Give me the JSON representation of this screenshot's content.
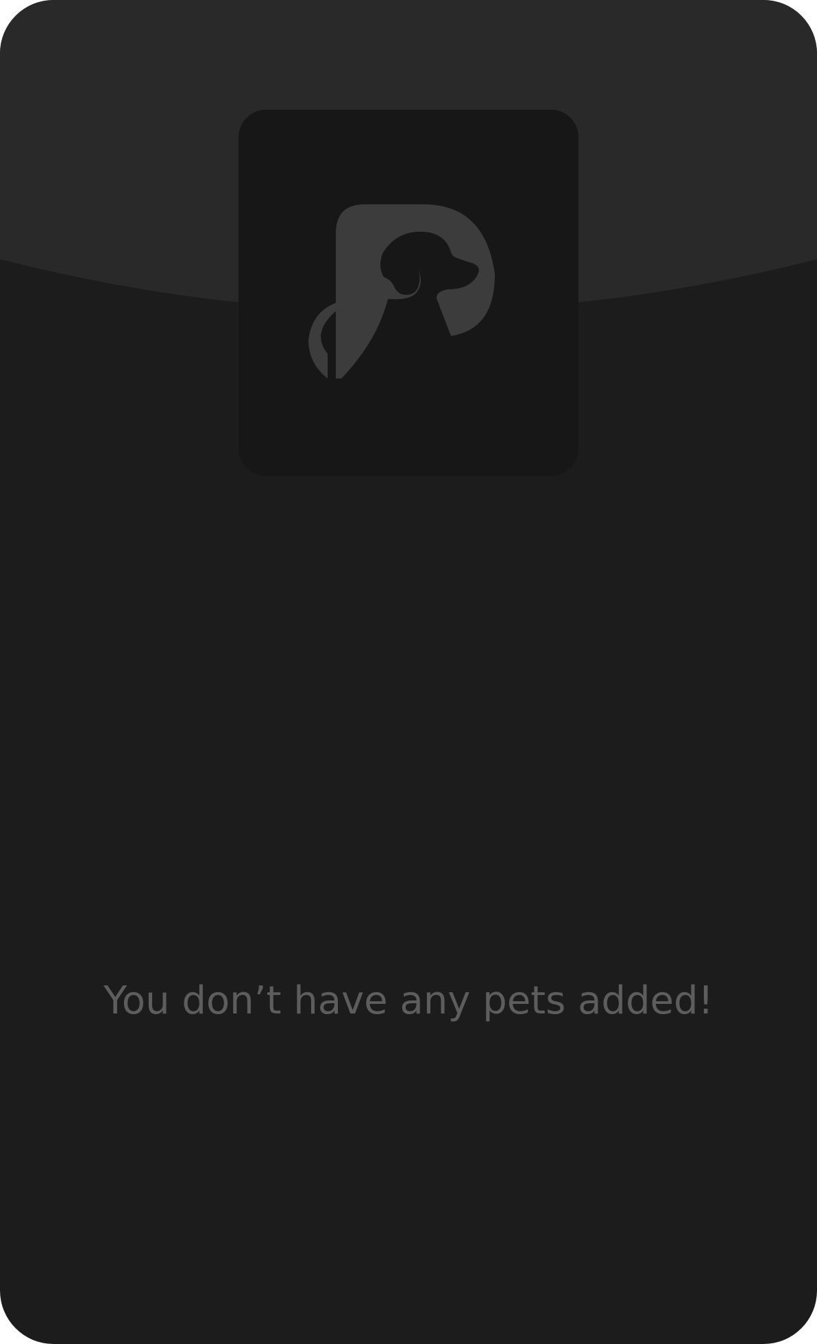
{
  "screen": {
    "empty_message": "You don’t have any pets added!"
  },
  "pet_photo": {
    "icon": "dog-logo-icon",
    "state": "placeholder"
  },
  "colors": {
    "card_background": "#1c1c1c",
    "header_background": "#292929",
    "photo_background": "#171717",
    "logo_color": "#3d3c3d",
    "message_color": "#5d5d5d"
  }
}
